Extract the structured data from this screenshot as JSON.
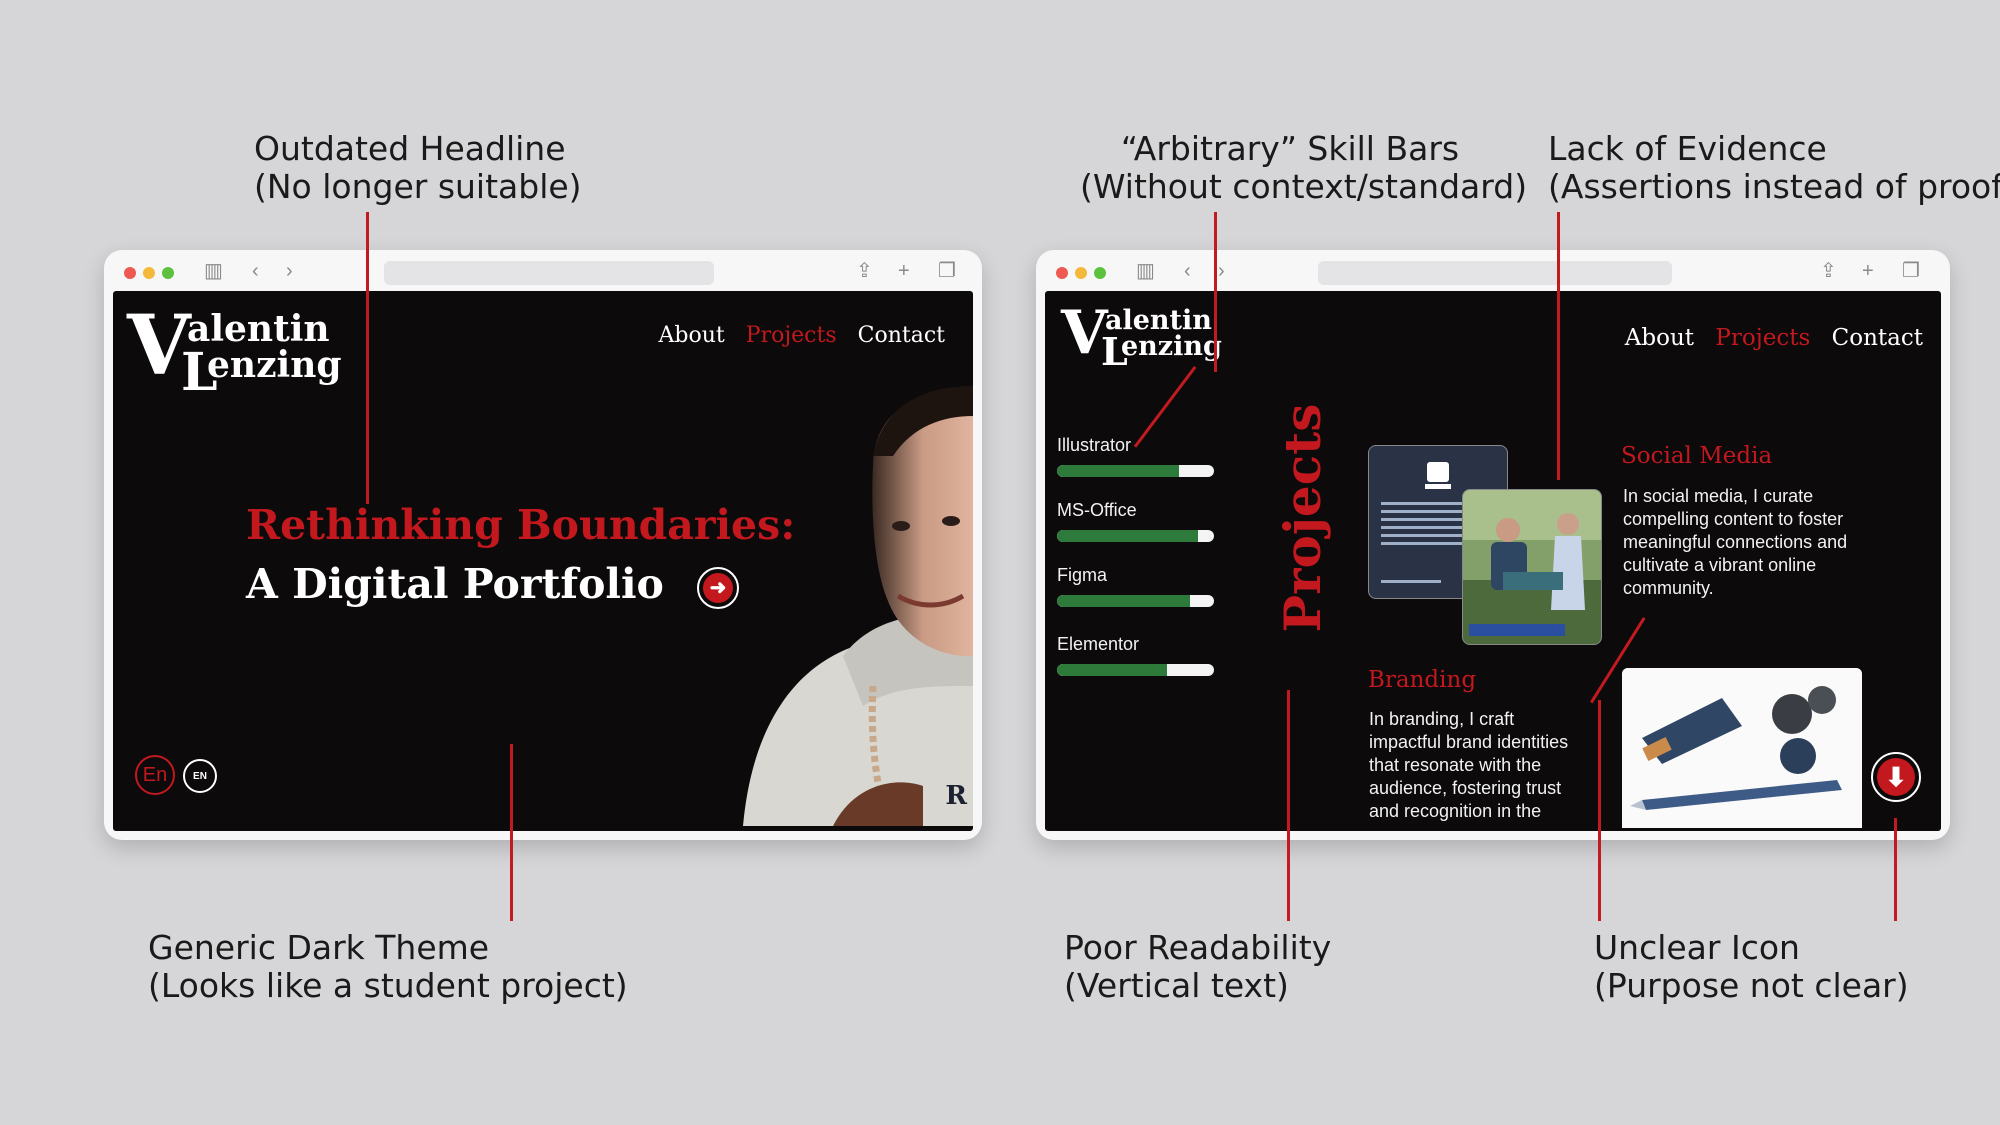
{
  "annotations": {
    "outdated_headline": {
      "line1": "Outdated Headline",
      "line2": "(No longer suitable)"
    },
    "skill_bars": {
      "line1": "“Arbitrary” Skill Bars",
      "line2": "(Without context/standard)"
    },
    "lack_of_evidence": {
      "line1": "Lack of Evidence",
      "line2": "(Assertions instead of proof)"
    },
    "dark_theme": {
      "line1": "Generic Dark Theme",
      "line2": "(Looks like a student project)"
    },
    "poor_readability": {
      "line1": "Poor Readability",
      "line2": "(Vertical text)"
    },
    "unclear_icon": {
      "line1": "Unclear Icon",
      "line2": "(Purpose not clear)"
    }
  },
  "colors": {
    "accent": "#c2181e",
    "background": "#0c0a0b",
    "skill_fill": "#2e7a3a",
    "page": "#d6d6d8"
  },
  "left_site": {
    "logo": {
      "big_v": "V",
      "line1": "alentin",
      "big_l": "L",
      "line2": "enzing"
    },
    "nav": {
      "about": "About",
      "projects": "Projects",
      "contact": "Contact"
    },
    "headline_red": "Rethinking Boundaries:",
    "headline_white": "A Digital Portfolio",
    "lang_active": "En",
    "lang_other": "EN",
    "hoodie_letter": "R"
  },
  "right_site": {
    "logo": {
      "big_v": "V",
      "line1": "alentin",
      "big_l": "L",
      "line2": "enzing"
    },
    "nav": {
      "about": "About",
      "projects": "Projects",
      "contact": "Contact"
    },
    "skills": [
      {
        "label": "Illustrator",
        "level": 0.78
      },
      {
        "label": "MS-Office",
        "level": 0.9
      },
      {
        "label": "Figma",
        "level": 0.85
      },
      {
        "label": "Elementor",
        "level": 0.7
      }
    ],
    "vertical_title": "Projects",
    "social_media": {
      "title": "Social Media",
      "text": "In social media, I curate compelling content to foster meaningful connections and cultivate a vibrant online community."
    },
    "branding": {
      "title": "Branding",
      "text": "In branding, I craft impactful brand identities that resonate with the audience, fostering trust and recognition in the"
    }
  }
}
